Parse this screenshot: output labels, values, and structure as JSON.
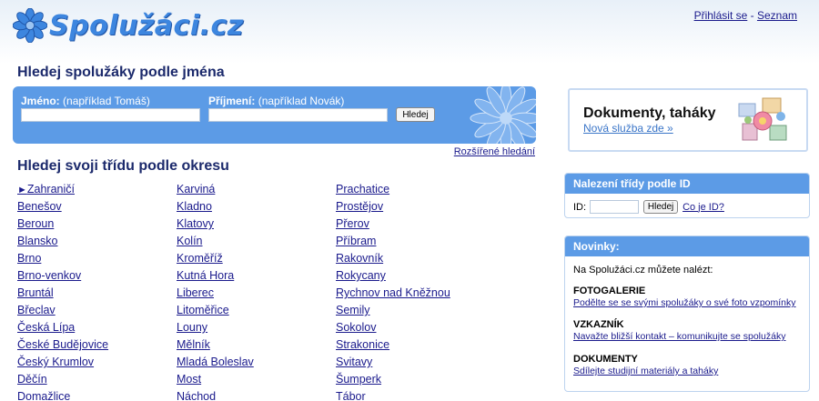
{
  "header": {
    "logo_text": "Spolužáci.cz",
    "login_label": "Přihlásit se",
    "separator": "-",
    "seznam_label": "Seznam"
  },
  "name_search": {
    "title": "Hledej spolužáky podle jména",
    "first_name_label": "Jméno:",
    "first_name_hint": "(například Tomáš)",
    "first_name_value": "",
    "last_name_label": "Příjmení:",
    "last_name_hint": "(například Novák)",
    "last_name_value": "",
    "button_label": "Hledej",
    "advanced_link": "Rozšířené hledání"
  },
  "district_search": {
    "title": "Hledej svoji třídu podle okresu",
    "columns": [
      [
        "Zahraničí",
        "Benešov",
        "Beroun",
        "Blansko",
        "Brno",
        "Brno-venkov",
        "Bruntál",
        "Břeclav",
        "Česká Lípa",
        "České Budějovice",
        "Český Krumlov",
        "Děčín",
        "Domažlice"
      ],
      [
        "Karviná",
        "Kladno",
        "Klatovy",
        "Kolín",
        "Kroměříž",
        "Kutná Hora",
        "Liberec",
        "Litoměřice",
        "Louny",
        "Mělník",
        "Mladá Boleslav",
        "Most",
        "Náchod"
      ],
      [
        "Prachatice",
        "Prostějov",
        "Přerov",
        "Příbram",
        "Rakovník",
        "Rokycany",
        "Rychnov nad Kněžnou",
        "Semily",
        "Sokolov",
        "Strakonice",
        "Svitavy",
        "Šumperk",
        "Tábor"
      ]
    ]
  },
  "promo": {
    "title": "Dokumenty, taháky",
    "link": "Nová služba zde »"
  },
  "id_panel": {
    "title": "Nalezení třídy podle ID",
    "label": "ID:",
    "value": "",
    "button_label": "Hledej",
    "help_link": "Co je ID?"
  },
  "news": {
    "title": "Novinky:",
    "intro": "Na Spolužáci.cz můžete nalézt:",
    "items": [
      {
        "heading": "FOTOGALERIE",
        "link": "Podělte se se svými spolužáky o své foto vzpomínky"
      },
      {
        "heading": "VZKAZNÍK",
        "link": "Navažte bližší kontakt – komunikujte se spolužáky"
      },
      {
        "heading": "DOKUMENTY",
        "link": "Sdílejte studijní materiály a taháky"
      }
    ]
  },
  "colors": {
    "brand_blue": "#5c9be6",
    "link": "#1a1a8c",
    "heading": "#1c2a6c"
  }
}
